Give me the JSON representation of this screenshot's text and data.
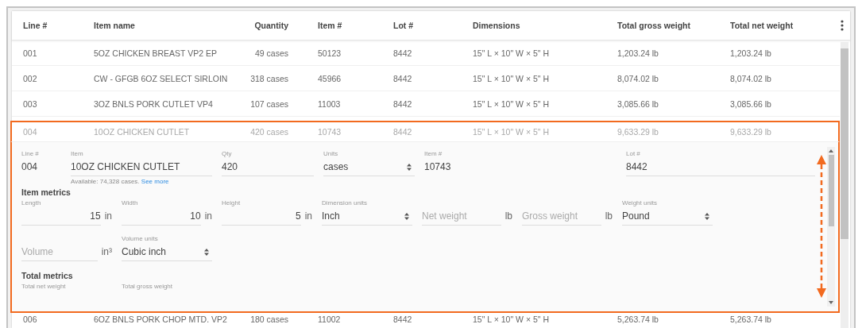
{
  "table": {
    "columns": [
      "Line #",
      "Item name",
      "Quantity",
      "Item #",
      "Lot #",
      "Dimensions",
      "Total gross weight",
      "Total net weight"
    ],
    "rows": [
      {
        "cells": [
          "001",
          "5OZ CHICKEN BREAST VP2 EP",
          "49 cases",
          "50123",
          "8442",
          "15\" L × 10\" W × 5\" H",
          "1,203.24 lb",
          "1,203.24 lb"
        ],
        "expanded": false
      },
      {
        "cells": [
          "002",
          "CW - GFGB 6OZ SELECT SIRLOIN",
          "318 cases",
          "45966",
          "8442",
          "15\" L × 10\" W × 5\" H",
          "8,074.02 lb",
          "8,074.02 lb"
        ],
        "expanded": false
      },
      {
        "cells": [
          "003",
          "3OZ BNLS PORK CUTLET VP4",
          "107 cases",
          "11003",
          "8442",
          "15\" L × 10\" W × 5\" H",
          "3,085.66 lb",
          "3,085.66 lb"
        ],
        "expanded": false
      },
      {
        "cells": [
          "004",
          "10OZ CHICKEN CUTLET",
          "420 cases",
          "10743",
          "8442",
          "15\" L × 10\" W × 5\" H",
          "9,633.29 lb",
          "9,633.29 lb"
        ],
        "expanded": true
      },
      {
        "cells": [
          "006",
          "6OZ BNLS PORK CHOP MTD. VP2",
          "180 cases",
          "11002",
          "8442",
          "15\" L × 10\" W × 5\" H",
          "5,263.74 lb",
          "5,263.74 lb"
        ],
        "expanded": false
      }
    ]
  },
  "detail": {
    "header_fields": [
      {
        "label": "Line #",
        "value": "004",
        "kind": "plain"
      },
      {
        "label": "Item",
        "value": "10OZ CHICKEN CUTLET",
        "kind": "text"
      },
      {
        "label": "Qty",
        "value": "420",
        "kind": "text"
      },
      {
        "label": "Units",
        "value": "cases",
        "kind": "select"
      },
      {
        "label": "Item #",
        "value": "10743",
        "kind": "plain"
      },
      {
        "label": "Lot #",
        "value": "8442",
        "kind": "text"
      }
    ],
    "hint": "Available: 74,328 cases.",
    "hint_link": "See more",
    "sections": [
      {
        "title": "Item metrics",
        "rows": [
          [
            {
              "label": "Length",
              "value": "15",
              "unit": "in",
              "kind": "number"
            },
            {
              "label": "Width",
              "value": "10",
              "unit": "in",
              "kind": "number"
            },
            {
              "label": "Height",
              "value": "5",
              "unit": "in",
              "kind": "number"
            },
            {
              "label": "Dimension units",
              "value": "Inch",
              "kind": "select"
            },
            {
              "placeholder": "Net weight",
              "unit": "lb",
              "kind": "number"
            },
            {
              "placeholder": "Gross weight",
              "unit": "lb",
              "kind": "number"
            },
            {
              "label": "Weight units",
              "value": "Pound",
              "kind": "select"
            }
          ],
          [
            {
              "placeholder": "Volume",
              "unit": "in³",
              "kind": "number"
            },
            {
              "label": "Volume units",
              "value": "Cubic inch",
              "kind": "select"
            }
          ]
        ]
      },
      {
        "title": "Total metrics",
        "rows": [
          [
            {
              "label": "Total net weight",
              "kind": "label"
            },
            {
              "label": "Total gross weight",
              "kind": "label"
            }
          ]
        ]
      }
    ]
  }
}
